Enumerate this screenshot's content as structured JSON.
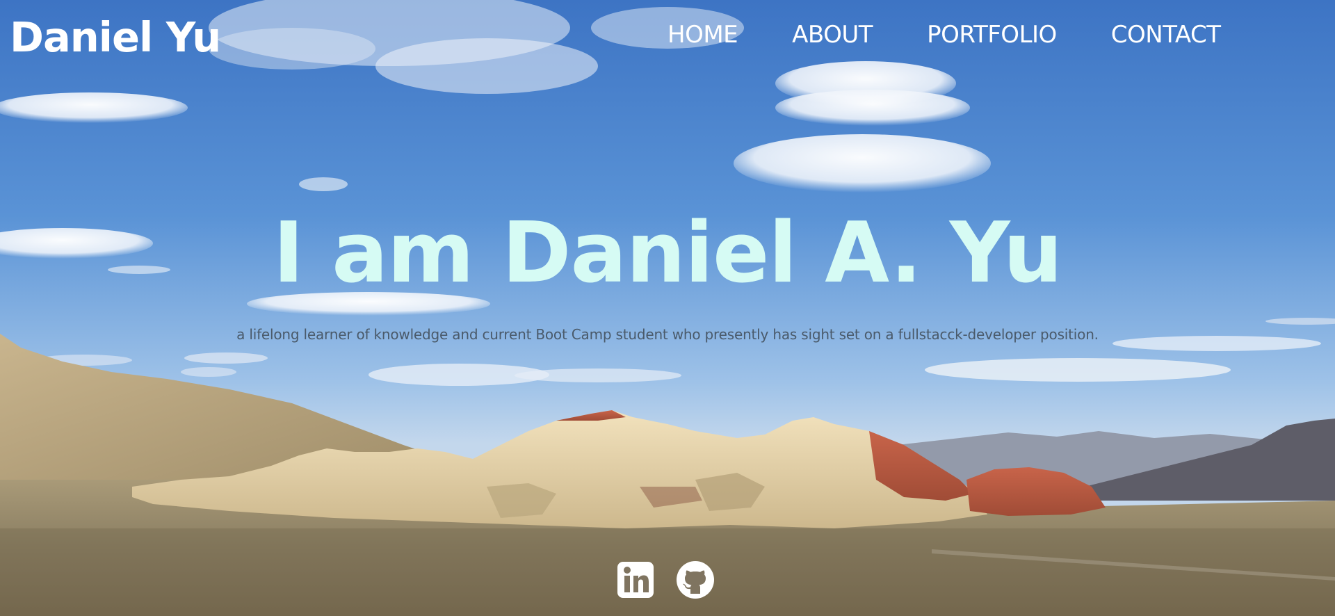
{
  "site": {
    "brand": "Daniel Yu"
  },
  "nav": {
    "items": [
      "HOME",
      "ABOUT",
      "PORTFOLIO",
      "CONTACT"
    ]
  },
  "hero": {
    "headline": "I am Daniel A. Yu",
    "tagline": "a lifelong learner of knowledge and current Boot Camp student who presently has sight set on a fullstacck-developer position.",
    "background": "desert-mountain-landscape-photo"
  },
  "social": {
    "icons": [
      "linkedin-icon",
      "github-icon"
    ]
  },
  "colors": {
    "headline": "#d6fbf4",
    "nav_text": "#ffffff",
    "tagline": "#4a5a6a",
    "sky_top": "#3f78c8",
    "sky_bottom": "#b4cfea"
  }
}
